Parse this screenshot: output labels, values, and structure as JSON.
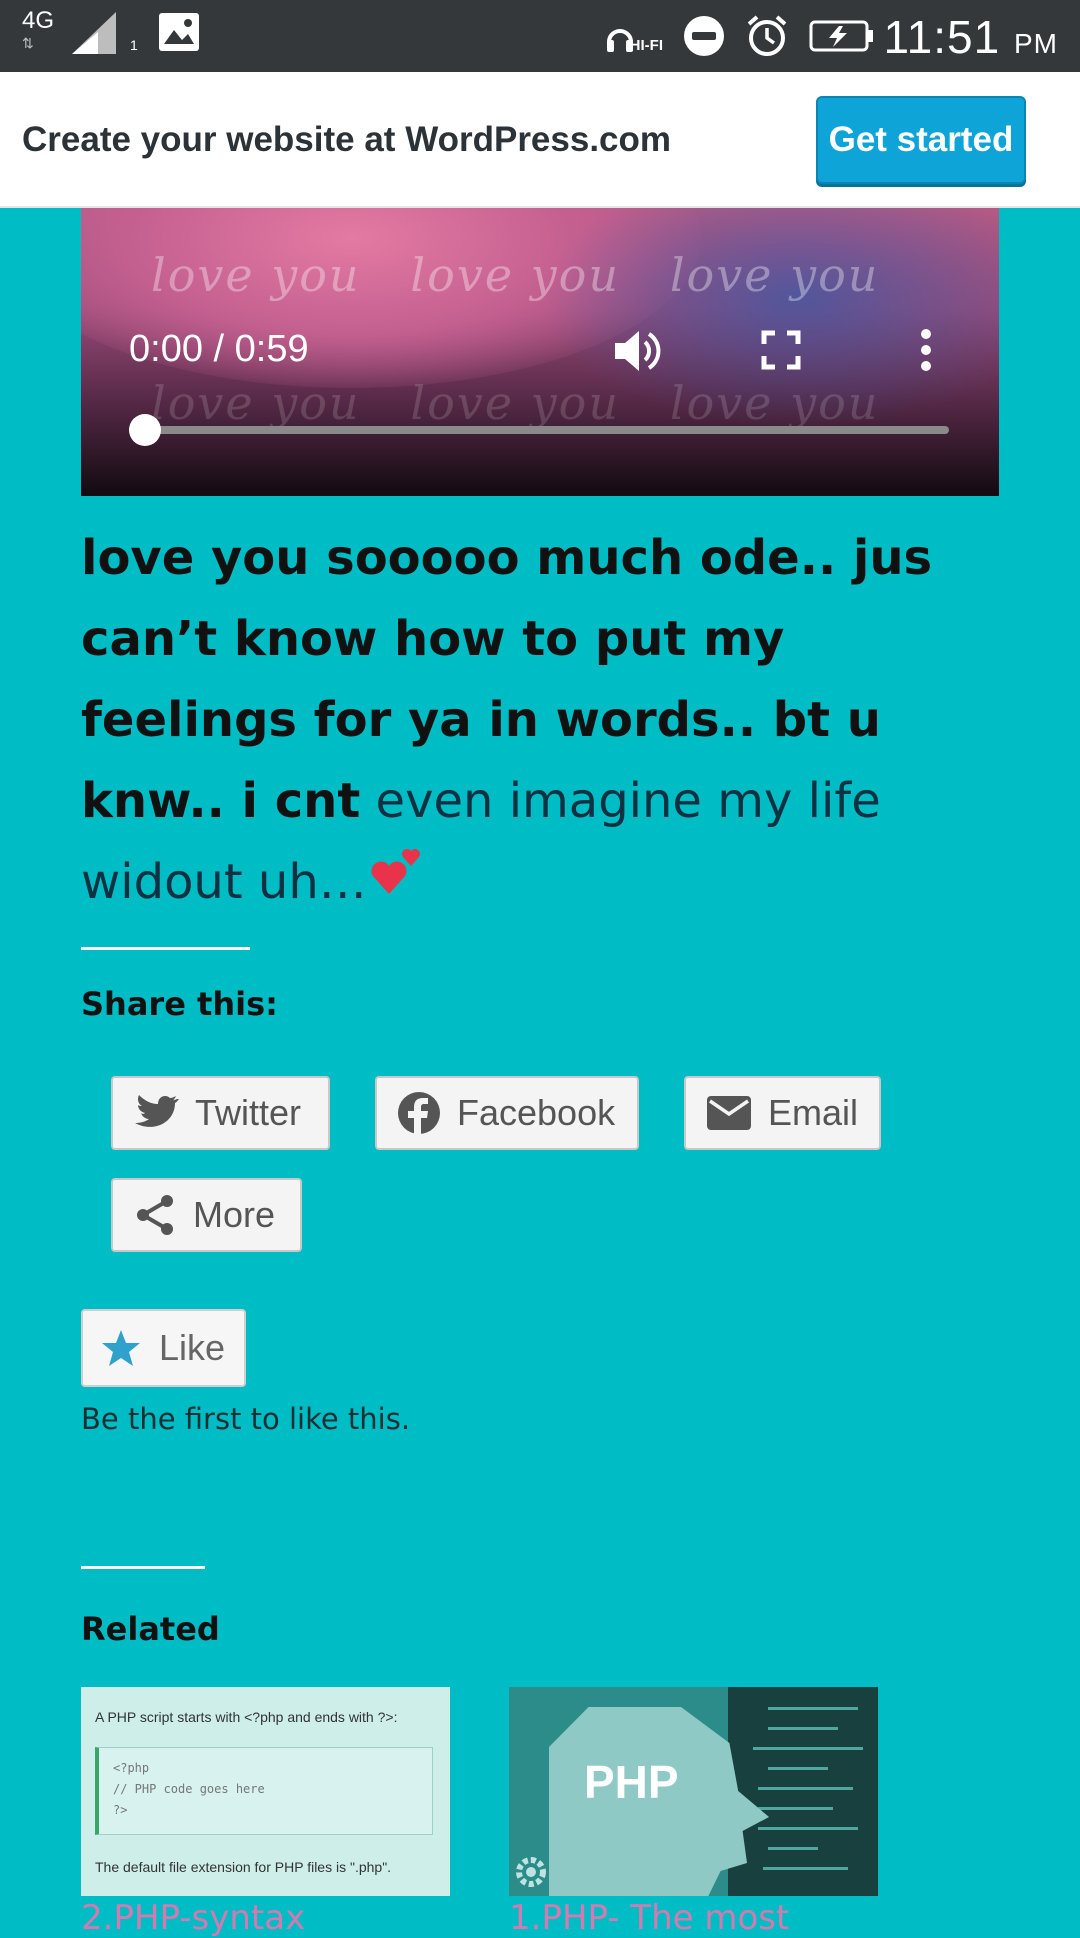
{
  "status_bar": {
    "network": "4G",
    "sim": "1",
    "hifi": "HI-FI",
    "time": "11:51",
    "ampm": "PM"
  },
  "banner": {
    "text": "Create your website at WordPress.com",
    "button": "Get started"
  },
  "video": {
    "time": "0:00 / 0:59",
    "overlay_text": "love you",
    "progress": 0
  },
  "post": {
    "bold_text": "love you sooooo much ode.. jus can’t know how to put my feelings for ya in words.. bt u knw.. i cnt",
    "light_text": " even imagine my life widout uh…",
    "emoji": "💕"
  },
  "share": {
    "heading": "Share this:",
    "buttons": [
      "Twitter",
      "Facebook",
      "Email",
      "More"
    ]
  },
  "like": {
    "button": "Like",
    "note": "Be the first to like this."
  },
  "related": {
    "heading": "Related",
    "thumb1": {
      "caption_top": "A PHP script starts with <?php and ends with ?>:",
      "code": [
        "<?php",
        "// PHP code goes here",
        "?>"
      ],
      "caption_bottom": "The default file extension for PHP files is \".php\"."
    },
    "thumb2": {
      "label": "PHP"
    },
    "links": [
      "2.PHP-syntax",
      "1.PHP- The most"
    ]
  },
  "colors": {
    "background": "#00bcc4",
    "accent_button": "#0ea4d8",
    "related_link": "#d47ab0"
  }
}
